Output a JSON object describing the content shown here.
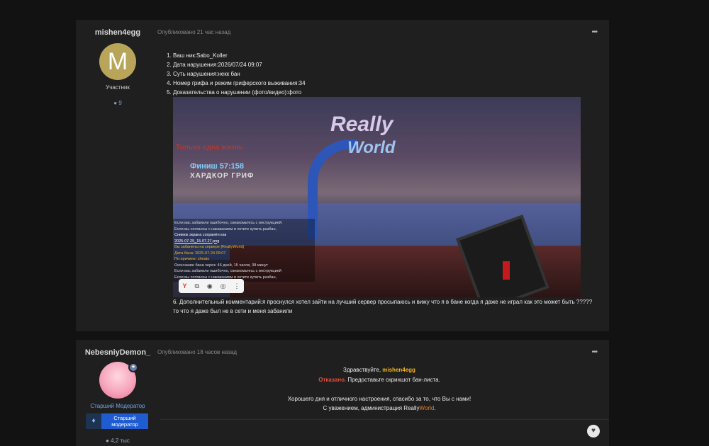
{
  "post1": {
    "author": "mishen4egg",
    "avatar_letter": "M",
    "role": "Участник",
    "reputation": "9",
    "date": "Опубликовано 21 час назад",
    "menu": "•••",
    "items": [
      "Ваш ник:Sabo_Koller",
      "Дата нарушения:2026/07/24 09:07",
      "Суть нарушения:некк бан",
      "Номер грифа и режим гриферского выживания:34",
      "Доказательства о нарушении (фото/видео):фото"
    ],
    "comment_number": "6.",
    "comment": "Дополнительный комментарий:я проснулся хотел зайти на лучший сервер просыпаюсь и вижу что я в бане когда я даже не играл как это может быть ????? то что я даже был не в сети и меня забанили",
    "screenshot": {
      "logo_line1": "Really",
      "logo_line2": "World",
      "hud_title": "Только одна жизнь",
      "hud_timer": "Финиш 57:158",
      "hud_mode": "ХАРДКОР ГРИФ",
      "chat": [
        "Если вас забанили ошибочно, ознакомьтесь с инструкцией:",
        "Если вы согласны с наказанием и хотите купить разбан,",
        "Снимок экрана сохранён как",
        "2025-07-25_15.07.27.png",
        "Вы забанены на сервере [ReallyWorld]",
        "Дата бана: 2025-07-24 09:07",
        "По причине: cheats",
        "Окончание бана через: 46 дней, 15 часов, 38 минут",
        "Если вас забанили ошибочно, ознакомьтесь с инструкцией",
        "Если вы согласны с наказанием и хотите купить разбан,"
      ]
    }
  },
  "post2": {
    "author": "NebesniyDemon_",
    "role": "Старший Модератор",
    "role_badge": "Старший модератор",
    "reputation": "4,2 тыс",
    "date": "Опубликовано 18 часов назад",
    "menu": "•••",
    "greeting": "Здравствуйте, ",
    "greeting_name": "mishen4egg",
    "verdict": "Отказано.",
    "verdict_text": " Предоставьте скриншот бан-листа.",
    "wish": "Хорошего дня и отличного настроения, спасибо за то, что Вы с нами!",
    "sign_prefix": "С уважением, администрация Really",
    "sign_brand": "World",
    "sign_suffix": "."
  },
  "colors": {
    "background": "#121212",
    "card": "#1f1f1f",
    "gold": "#f2b51b",
    "red": "#e74c3c",
    "moderator_blue": "#1f5cd1"
  }
}
